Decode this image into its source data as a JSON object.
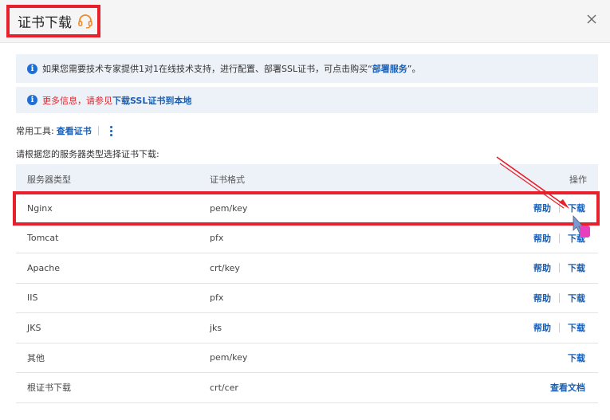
{
  "dialog": {
    "title": "证书下载",
    "headset_icon": "headset-icon",
    "close_icon": "close-icon"
  },
  "notices": {
    "consult_text": "如果您需要技术专家提供1对1在线技术支持，进行配置、部署SSL证书，可点击购买“",
    "consult_link": "部署服务",
    "consult_tail": "”。",
    "more_info_text": "更多信息，请参见",
    "more_info_link": "下载SSL证书到本地"
  },
  "tools": {
    "label": "常用工具:",
    "view_cert": "查看证书"
  },
  "prompt": "请根据您的服务器类型选择证书下载:",
  "table": {
    "headers": {
      "server_type": "服务器类型",
      "format": "证书格式",
      "action": "操作"
    },
    "rows": [
      {
        "type": "Nginx",
        "format": "pem/key",
        "help": "帮助",
        "download": "下载"
      },
      {
        "type": "Tomcat",
        "format": "pfx",
        "help": "帮助",
        "download": "下载"
      },
      {
        "type": "Apache",
        "format": "crt/key",
        "help": "帮助",
        "download": "下载"
      },
      {
        "type": "IIS",
        "format": "pfx",
        "help": "帮助",
        "download": "下载"
      },
      {
        "type": "JKS",
        "format": "jks",
        "help": "帮助",
        "download": "下载"
      },
      {
        "type": "其他",
        "format": "pem/key",
        "download": "下载"
      },
      {
        "type": "根证书下载",
        "format": "crt/cer",
        "docs": "查看文档"
      }
    ]
  },
  "colors": {
    "accent": "#1a5fb4",
    "highlight": "#e8202b",
    "notice_bg": "#edf2f8"
  }
}
